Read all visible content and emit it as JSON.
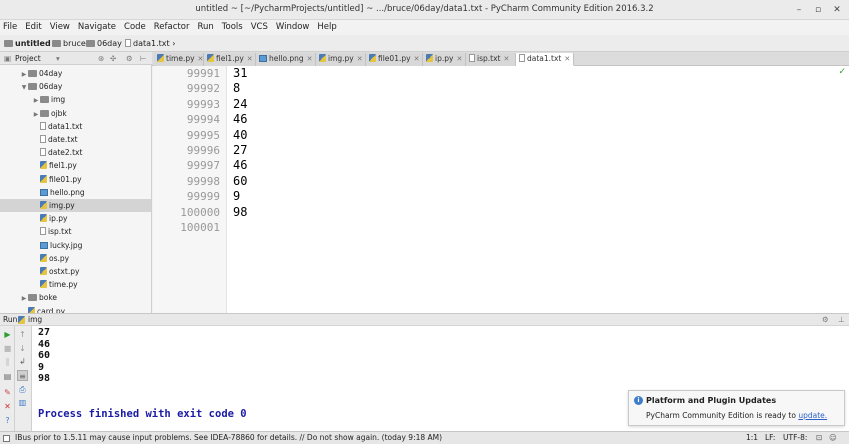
{
  "window": {
    "title": "untitled ~ [~/PycharmProjects/untitled] ~ .../bruce/06day/data1.txt - PyCharm Community Edition 2016.3.2"
  },
  "menu": [
    "File",
    "Edit",
    "View",
    "Navigate",
    "Code",
    "Refactor",
    "Run",
    "Tools",
    "VCS",
    "Window",
    "Help"
  ],
  "breadcrumb": {
    "root": "untitled",
    "c1": "bruce",
    "c2": "06day",
    "c3": "data1.txt"
  },
  "toolbar": {
    "config": "img"
  },
  "project": {
    "label": "Project"
  },
  "tabs": [
    "time.py",
    "fiel1.py",
    "hello.png",
    "img.py",
    "file01.py",
    "ip.py",
    "isp.txt",
    "data1.txt"
  ],
  "tree": [
    {
      "label": "04day",
      "type": "folder",
      "expand": "▶",
      "indent": 1
    },
    {
      "label": "06day",
      "type": "folder",
      "expand": "▼",
      "indent": 1
    },
    {
      "label": "img",
      "type": "folder",
      "expand": "▶",
      "indent": 2
    },
    {
      "label": "ojbk",
      "type": "folder",
      "expand": "▶",
      "indent": 2
    },
    {
      "label": "data1.txt",
      "type": "file",
      "expand": "",
      "indent": 2
    },
    {
      "label": "date.txt",
      "type": "file",
      "expand": "",
      "indent": 2
    },
    {
      "label": "date2.txt",
      "type": "file",
      "expand": "",
      "indent": 2
    },
    {
      "label": "fiel1.py",
      "type": "py",
      "expand": "",
      "indent": 2
    },
    {
      "label": "file01.py",
      "type": "py",
      "expand": "",
      "indent": 2
    },
    {
      "label": "hello.png",
      "type": "img",
      "expand": "",
      "indent": 2
    },
    {
      "label": "img.py",
      "type": "py",
      "expand": "",
      "indent": 2,
      "selected": true
    },
    {
      "label": "ip.py",
      "type": "py",
      "expand": "",
      "indent": 2
    },
    {
      "label": "isp.txt",
      "type": "file",
      "expand": "",
      "indent": 2
    },
    {
      "label": "lucky.jpg",
      "type": "img",
      "expand": "",
      "indent": 2
    },
    {
      "label": "os.py",
      "type": "py",
      "expand": "",
      "indent": 2
    },
    {
      "label": "ostxt.py",
      "type": "py",
      "expand": "",
      "indent": 2
    },
    {
      "label": "time.py",
      "type": "py",
      "expand": "",
      "indent": 2
    },
    {
      "label": "boke",
      "type": "folder",
      "expand": "▶",
      "indent": 1
    },
    {
      "label": "card.py",
      "type": "py",
      "expand": "",
      "indent": 1
    }
  ],
  "editor": {
    "line_numbers": [
      "99991",
      "99992",
      "99993",
      "99994",
      "99995",
      "99996",
      "99997",
      "99998",
      "99999",
      "100000",
      "100001"
    ],
    "lines": [
      "31",
      "8",
      "24",
      "46",
      "40",
      "27",
      "46",
      "60",
      "9",
      "98",
      ""
    ]
  },
  "run": {
    "label": "Run",
    "config": "img"
  },
  "console": {
    "lines": [
      "27",
      "46",
      "60",
      "9",
      "98"
    ],
    "finish": "Process finished with exit code 0"
  },
  "notification": {
    "title": "Platform and Plugin Updates",
    "text": "PyCharm Community Edition is ready to",
    "link": "update."
  },
  "status": {
    "message": "IBus prior to 1.5.11 may cause input problems. See IDEA-78860 for details. // Do not show again. (today 9:18 AM)",
    "position": "1:1",
    "line_sep": "LF:",
    "encoding": "UTF-8:"
  }
}
